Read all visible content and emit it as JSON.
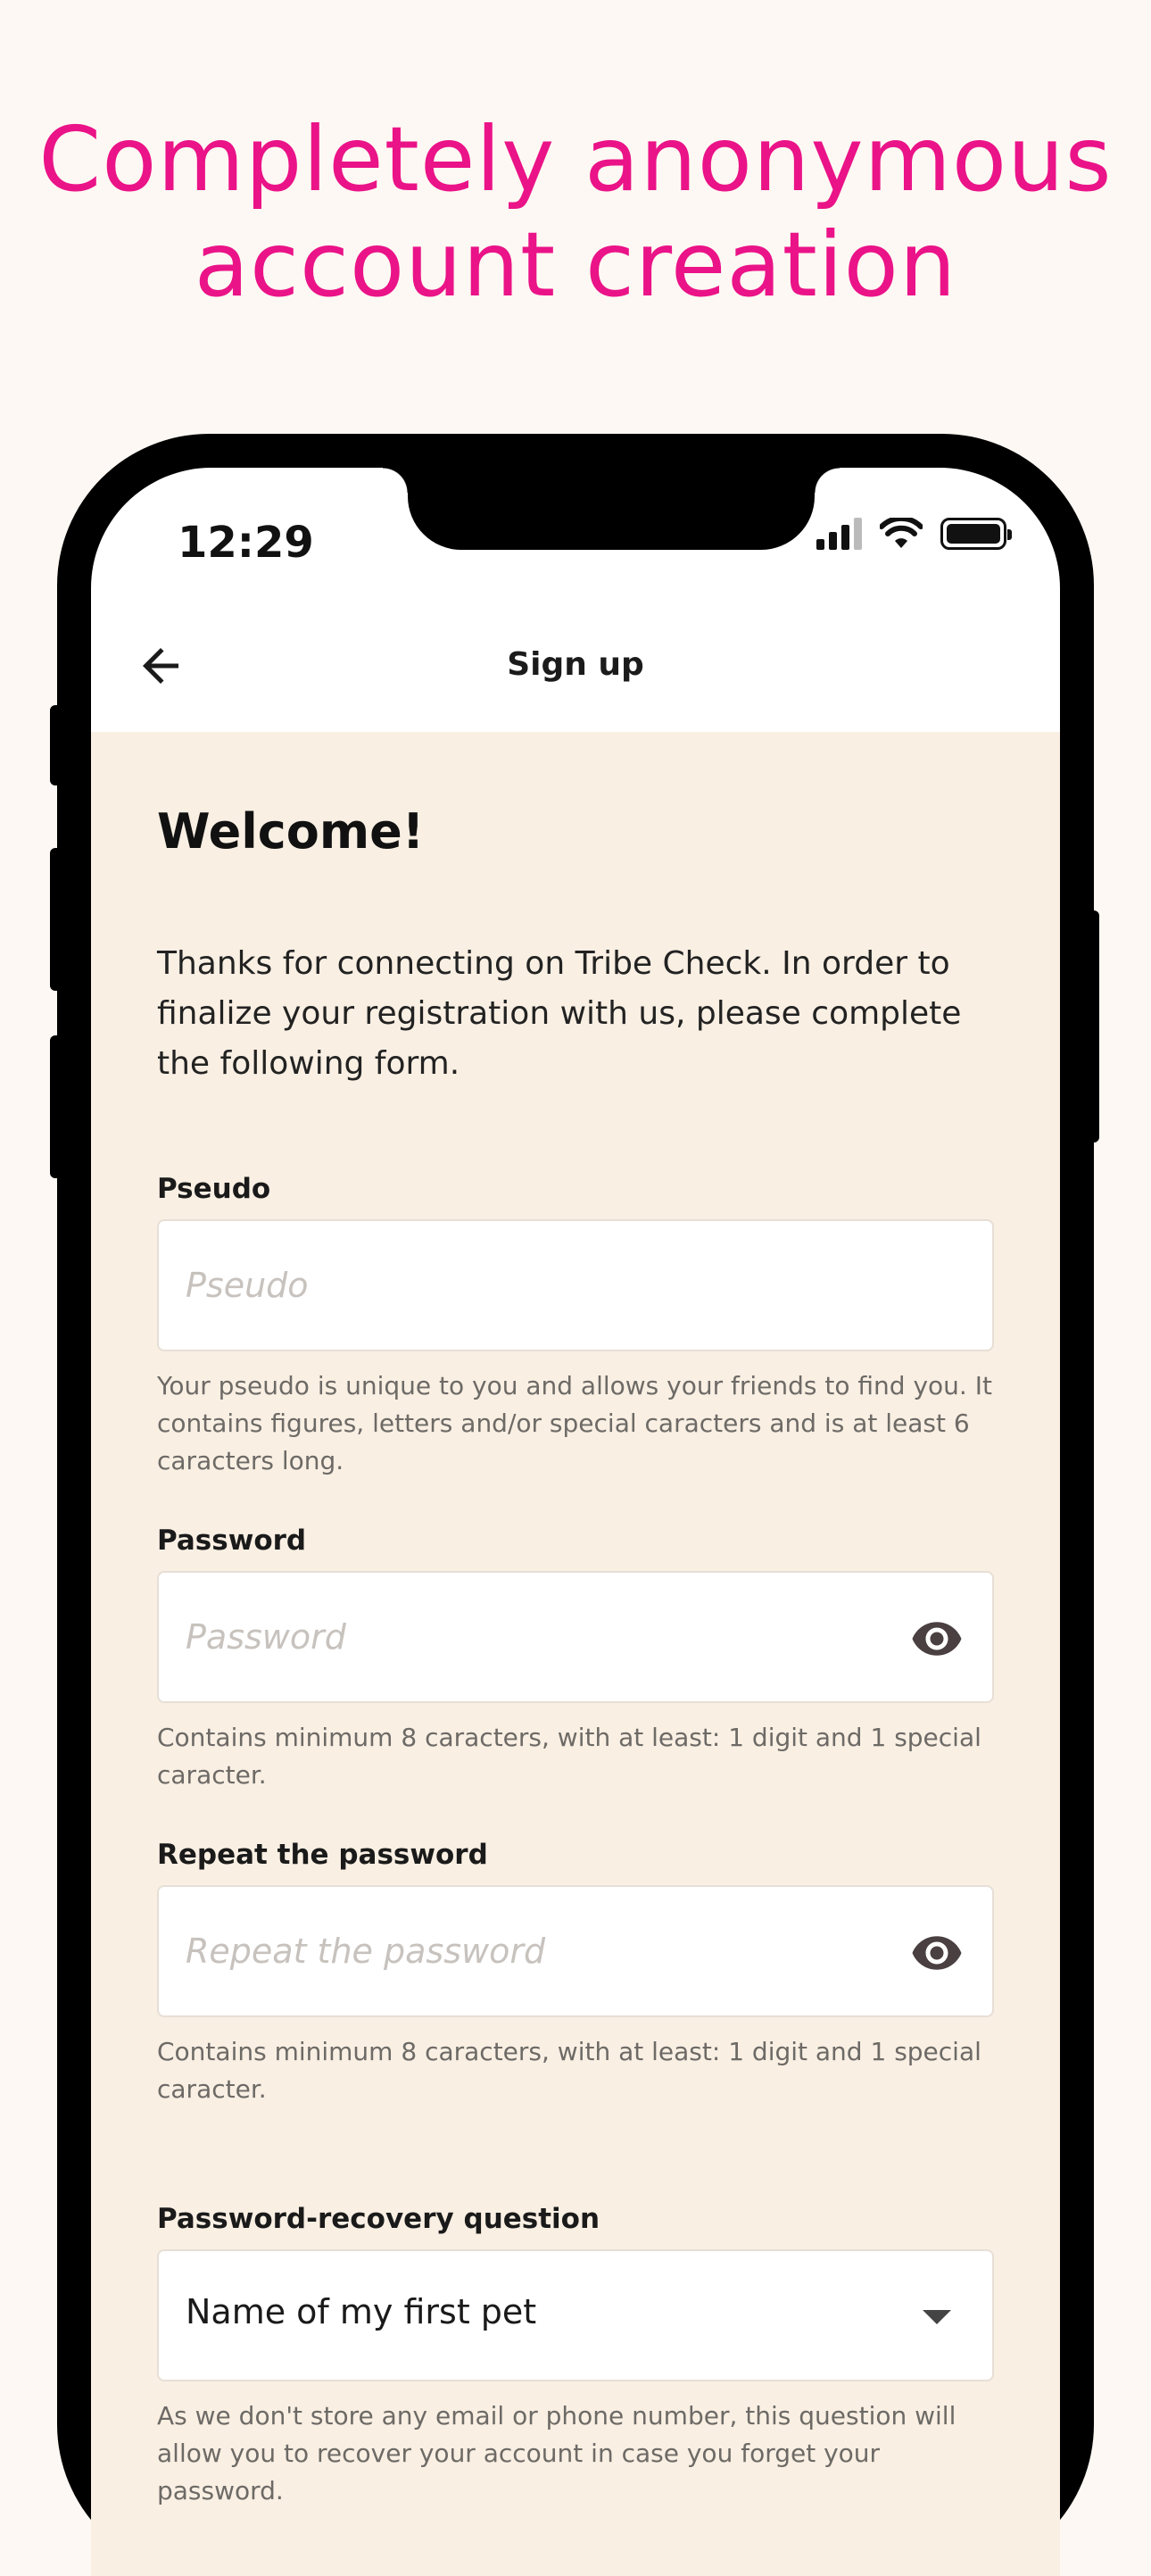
{
  "headline": {
    "line1": "Completely anonymous",
    "line2": "account creation"
  },
  "status_bar": {
    "time": "12:29",
    "icons": [
      "signal-icon",
      "wifi-icon",
      "battery-icon"
    ]
  },
  "app_bar": {
    "title": "Sign up",
    "back_icon": "arrow-left-icon"
  },
  "content": {
    "welcome": "Welcome!",
    "intro": "Thanks for connecting on Tribe Check. In order to finalize your registration with us, please complete the following form."
  },
  "form": {
    "pseudo": {
      "label": "Pseudo",
      "placeholder": "Pseudo",
      "value": "",
      "hint": "Your pseudo is unique to you and allows your friends to find you. It contains figures, letters and/or special caracters and is at least 6 caracters long."
    },
    "password": {
      "label": "Password",
      "placeholder": "Password",
      "value": "",
      "hint": "Contains minimum 8 caracters, with at least: 1 digit and 1 special caracter."
    },
    "repeat_password": {
      "label": "Repeat the password",
      "placeholder": "Repeat the password",
      "value": "",
      "hint": "Contains minimum 8 caracters, with at least: 1 digit and 1 special caracter."
    },
    "recovery_question": {
      "label": "Password-recovery question",
      "selected": "Name of my first pet",
      "hint": "As we don't store any email or phone number, this question will allow you to recover your account in case you forget your password."
    }
  },
  "colors": {
    "accent": "#ea1388",
    "background": "#fdf8f3",
    "form_background": "#f9efe3",
    "eye_icon": "#4a3f41"
  }
}
